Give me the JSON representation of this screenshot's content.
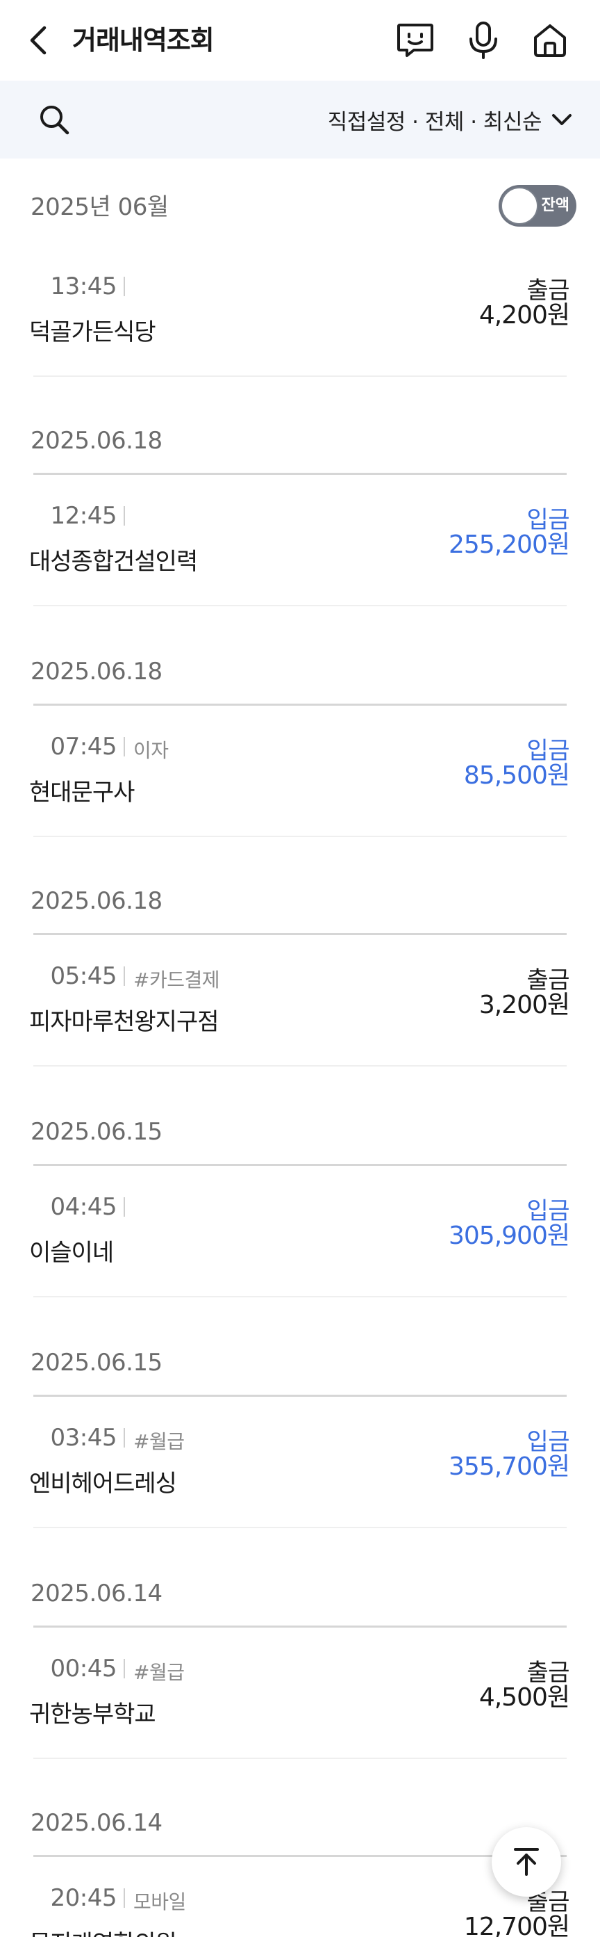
{
  "header": {
    "title": "거래내역조회",
    "back_icon": "chevron-left-icon",
    "icons": [
      "chat-icon",
      "microphone-icon",
      "home-icon"
    ]
  },
  "filter": {
    "search_icon": "search-icon",
    "label": "직접설정 · 전체 · 최신순",
    "dropdown_icon": "chevron-down-icon"
  },
  "month": {
    "label": "2025년 06월",
    "balance_toggle_label": "잔액"
  },
  "transactions": [
    {
      "date": "",
      "time": "13:45",
      "memo": "",
      "name": "덕골가든식당",
      "type": "출금",
      "amount": "4,200원",
      "direction": "out"
    },
    {
      "date": "2025.06.18",
      "time": "12:45",
      "memo": "",
      "name": "대성종합건설인력",
      "type": "입금",
      "amount": "255,200원",
      "direction": "in"
    },
    {
      "date": "2025.06.18",
      "time": "07:45",
      "memo": "이자",
      "name": "현대문구사",
      "type": "입금",
      "amount": "85,500원",
      "direction": "in"
    },
    {
      "date": "2025.06.18",
      "time": "05:45",
      "memo": "#카드결제",
      "name": "피자마루천왕지구점",
      "type": "출금",
      "amount": "3,200원",
      "direction": "out"
    },
    {
      "date": "2025.06.15",
      "time": "04:45",
      "memo": "",
      "name": "이슬이네",
      "type": "입금",
      "amount": "305,900원",
      "direction": "in"
    },
    {
      "date": "2025.06.15",
      "time": "03:45",
      "memo": "#월급",
      "name": "엔비헤어드레싱",
      "type": "입금",
      "amount": "355,700원",
      "direction": "in"
    },
    {
      "date": "2025.06.14",
      "time": "00:45",
      "memo": "#월급",
      "name": "귀한농부학교",
      "type": "출금",
      "amount": "4,500원",
      "direction": "out"
    },
    {
      "date": "2025.06.14",
      "time": "20:45",
      "memo": "모바일",
      "name": "문지개역합의원",
      "type": "출금",
      "amount": "12,700원",
      "direction": "out"
    }
  ],
  "scroll_top_icon": "arrow-up-icon",
  "colors": {
    "deposit": "#3b6fe0",
    "withdraw": "#1a1a1a",
    "filter_bg": "#f3f6fb"
  }
}
